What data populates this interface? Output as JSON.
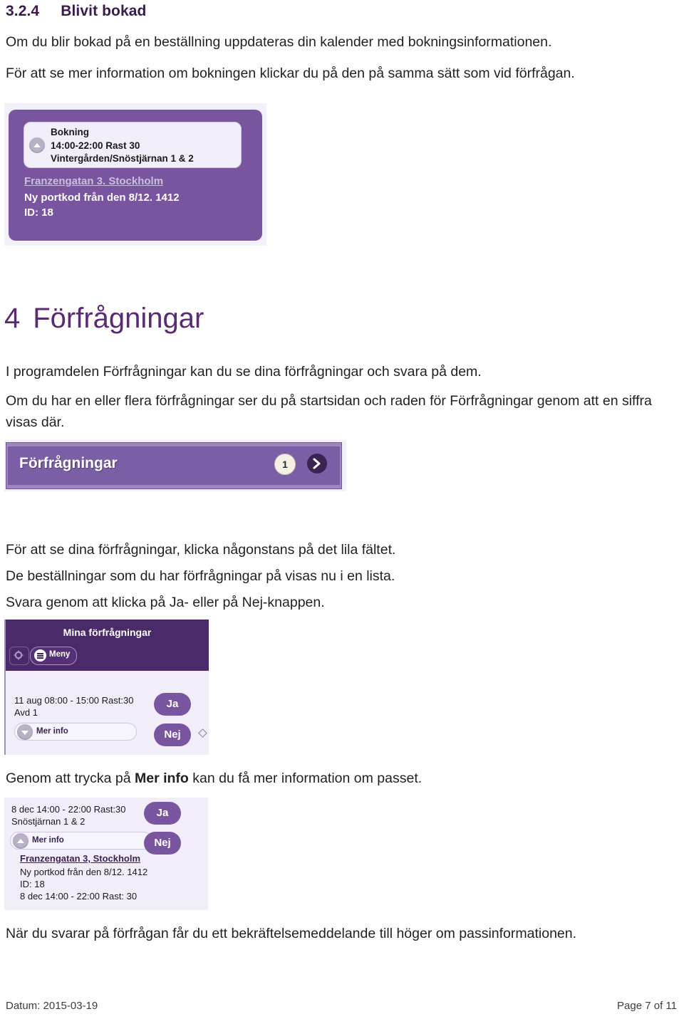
{
  "document": {
    "heading_section": {
      "number": "3.2.4",
      "title": "Blivit bokad"
    },
    "para_1": "Om du blir bokad på en beställning uppdateras din kalender med bokningsinformationen.",
    "para_2": "För att se mer information om bokningen klickar du på den på samma sätt som vid förfrågan.",
    "heading_chapter": {
      "number": "4",
      "title": "Förfrågningar"
    },
    "para_3": "I programdelen Förfrågningar kan du se dina förfrågningar och svara på dem.",
    "para_4": "Om du har en eller flera förfrågningar ser du på startsidan och raden för Förfrågningar genom att en siffra visas där.",
    "para_5": "För att se dina förfrågningar, klicka någonstans på det lila fältet.",
    "para_6": "De beställningar som du har förfrågningar på visas nu i en lista.",
    "para_7": "Svara genom att klicka på Ja- eller på Nej-knappen.",
    "para_8_prefix": "Genom att trycka på ",
    "para_8_bold": "Mer info",
    "para_8_suffix": " kan du få mer information om passet.",
    "para_9": "När du svarar på förfrågan får du ett bekräftelsemeddelande till höger om passinformationen.",
    "footer_date": "Datum: 2015-03-19",
    "footer_page": "Page 7 of 11"
  },
  "screenshot_booking_card": {
    "collapse_icon": "chevron-up-icon",
    "title": "Bokning",
    "time": "14:00-22:00 Rast 30",
    "location": "Vintergården/Snöstjärnan 1 & 2",
    "address": "Franzengatan 3. Stockholm",
    "note": "Ny portkod från den 8/12. 1412",
    "id": "ID: 18",
    "card_color": "#7a559f",
    "inner_color": "#f1eefa"
  },
  "screenshot_requests_bar": {
    "label": "Förfrågningar",
    "count_badge": "1",
    "next_icon": "chevron-right-icon",
    "bar_color": "#7a5fa6",
    "frame_color": "#9c86c0"
  },
  "screenshot_my_requests": {
    "header_title": "Mina förfrågningar",
    "gear_icon": "gear-icon",
    "menu_icon": "hamburger-menu-icon",
    "menu_label": "Meny",
    "row": {
      "time": "11 aug 08:00 - 15:00 Rast:30",
      "department": "Avd 1",
      "more_info_icon": "chevron-down-icon",
      "more_info_label": "Mer info",
      "yes_label": "Ja",
      "no_label": "Nej"
    },
    "header_color": "#4b2a69",
    "body_color": "#f1eefa"
  },
  "screenshot_more_info_expanded": {
    "time": "8 dec 14:00 - 22:00 Rast:30",
    "location": "Snöstjärnan 1 & 2",
    "more_info_icon": "chevron-up-icon",
    "more_info_label": "Mer info",
    "address": "Franzengatan 3, Stockholm",
    "note": "Ny portkod från den 8/12. 1412",
    "id": "ID: 18",
    "time_repeat": "8 dec 14:00 - 22:00 Rast: 30",
    "yes_label": "Ja",
    "no_label": "Nej"
  }
}
